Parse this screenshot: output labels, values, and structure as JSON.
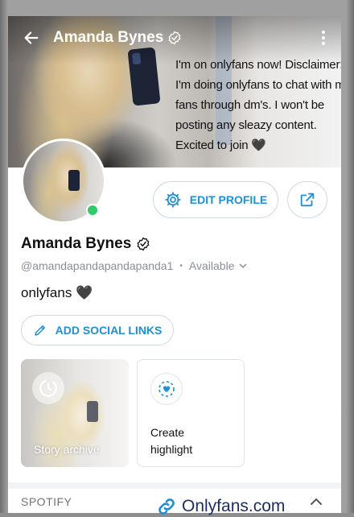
{
  "header": {
    "title": "Amanda Bynes",
    "cover_text": [
      "I'm on onlyfans now! Disclaimer:",
      "I'm doing onlyfans to chat with my",
      "fans through dm's. I won't be",
      "posting any sleazy content.",
      "Excited to join 🖤"
    ]
  },
  "profile": {
    "name": "Amanda Bynes",
    "handle": "@amandapandapandapanda1",
    "separator": "•",
    "status": "Available",
    "bio": "onlyfans 🖤",
    "online": true
  },
  "buttons": {
    "edit_profile": "EDIT PROFILE",
    "add_social_links": "ADD SOCIAL LINKS"
  },
  "cards": {
    "story_archive": "Story archive",
    "create_highlight_line1": "Create",
    "create_highlight_line2": "highlight"
  },
  "sections": {
    "spotify": "SPOTIFY"
  },
  "watermark": {
    "text": "Onlyfans.com"
  },
  "colors": {
    "accent": "#1f8fd6",
    "online": "#2fcb6b",
    "muted": "#8a8f98"
  },
  "icons": [
    "back-arrow-icon",
    "verified-icon",
    "more-vertical-icon",
    "gear-icon",
    "share-icon",
    "chevron-down-icon",
    "pencil-icon",
    "story-archive-icon",
    "highlight-heart-icon",
    "chevron-up-icon",
    "link-icon"
  ]
}
